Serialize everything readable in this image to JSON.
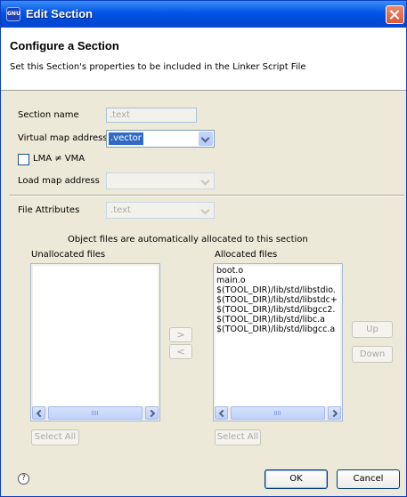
{
  "window": {
    "title": "Edit Section",
    "app_icon_text": "GNU"
  },
  "header": {
    "title": "Configure a Section",
    "description": "Set this Section's properties to be included in the Linker Script File"
  },
  "form": {
    "section_name": {
      "label": "Section name",
      "value": ".text"
    },
    "virtual_map_address": {
      "label": "Virtual map address",
      "value": ".vector"
    },
    "lma_vma": {
      "label": "LMA ≠ VMA",
      "checked": false
    },
    "load_map_address": {
      "label": "Load map address",
      "value": ""
    },
    "file_attributes": {
      "label": "File Attributes",
      "value": ".text"
    }
  },
  "allocation": {
    "note": "Object files are automatically allocated to this section",
    "unallocated": {
      "label": "Unallocated files",
      "items": []
    },
    "allocated": {
      "label": "Allocated files",
      "items": [
        "boot.o",
        "main.o",
        "$(TOOL_DIR)/lib/std/libstdio.",
        "$(TOOL_DIR)/lib/std/libstdc+",
        "$(TOOL_DIR)/lib/std/libgcc2.",
        "$(TOOL_DIR)/lib/std/libc.a",
        "$(TOOL_DIR)/lib/std/libgcc.a"
      ]
    },
    "move_right": ">",
    "move_left": "<",
    "up": "Up",
    "down": "Down",
    "select_all_unallocated": "Select All",
    "select_all_allocated": "Select All"
  },
  "footer": {
    "help": "?",
    "ok": "OK",
    "cancel": "Cancel"
  },
  "colors": {
    "titlebar": "#0055e5",
    "selection": "#316ac5",
    "dialog_bg": "#ece9d8"
  }
}
